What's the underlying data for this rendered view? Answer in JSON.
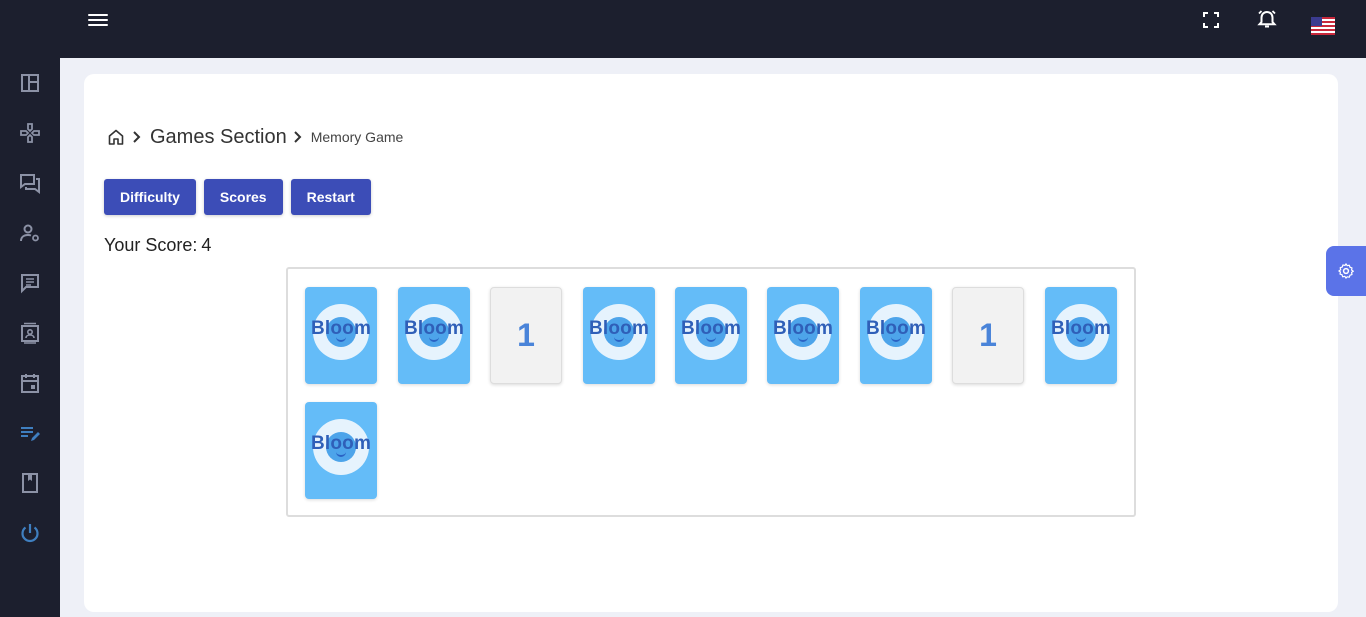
{
  "header": {
    "icons": [
      "menu-icon",
      "fullscreen-icon",
      "bell-icon",
      "us-flag-icon"
    ]
  },
  "sidebar": {
    "items": [
      {
        "icon": "dashboard-icon"
      },
      {
        "icon": "gamepad-icon"
      },
      {
        "icon": "chat-icon"
      },
      {
        "icon": "user-settings-icon"
      },
      {
        "icon": "message-icon"
      },
      {
        "icon": "contact-card-icon"
      },
      {
        "icon": "calendar-icon"
      },
      {
        "icon": "edit-list-icon"
      },
      {
        "icon": "book-icon"
      },
      {
        "icon": "power-icon"
      }
    ]
  },
  "breadcrumb": {
    "home_icon": "home-icon",
    "section": "Games Section",
    "current": "Memory Game"
  },
  "toolbar": {
    "difficulty_label": "Difficulty",
    "scores_label": "Scores",
    "restart_label": "Restart"
  },
  "score": {
    "label": "Your Score:",
    "value": "4"
  },
  "board": {
    "tiles": [
      {
        "state": "back",
        "logo": "Bloom"
      },
      {
        "state": "back",
        "logo": "Bloom"
      },
      {
        "state": "face",
        "value": "1"
      },
      {
        "state": "back",
        "logo": "Bloom"
      },
      {
        "state": "back",
        "logo": "Bloom"
      },
      {
        "state": "back",
        "logo": "Bloom"
      },
      {
        "state": "back",
        "logo": "Bloom"
      },
      {
        "state": "face",
        "value": "1"
      },
      {
        "state": "back",
        "logo": "Bloom"
      },
      {
        "state": "back",
        "logo": "Bloom"
      }
    ]
  },
  "colors": {
    "topbar": "#1c1f2e",
    "primary_button": "#3c4db7",
    "tile_back": "#64bcf8",
    "settings_fab": "#5b73e8"
  }
}
